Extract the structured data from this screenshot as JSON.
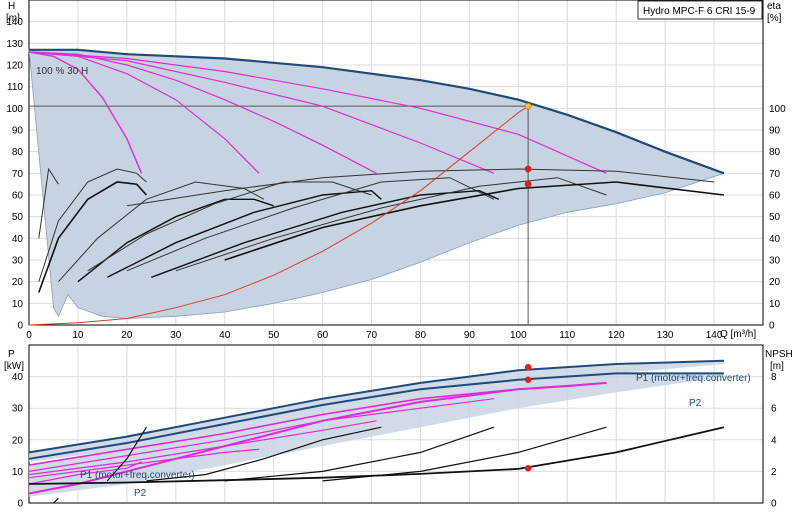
{
  "title": "Hydro MPC-F 6 CRI 15-9",
  "chart_data": [
    {
      "id": "head",
      "type": "line",
      "ylabel_left": "H",
      "yunit_left": "[m]",
      "ylabel_right": "eta",
      "yunit_right": "[%]",
      "xlabel": "Q [m³/h]",
      "xlim": [
        0,
        150
      ],
      "ylim": [
        0,
        150
      ],
      "ylim_right": [
        0,
        150
      ],
      "xticks": [
        "0",
        "10",
        "20",
        "30",
        "40",
        "50",
        "60",
        "70",
        "80",
        "90",
        "100",
        "110",
        "120",
        "130",
        "140"
      ],
      "yticks_left": [
        "0",
        "10",
        "20",
        "30",
        "40",
        "50",
        "60",
        "70",
        "80",
        "90",
        "100",
        "110",
        "120",
        "130",
        "140"
      ],
      "yticks_right": [
        "0",
        "10",
        "20",
        "30",
        "40",
        "50",
        "60",
        "70",
        "80",
        "90",
        "100"
      ],
      "annotation": "100 % 30 H",
      "grid": true,
      "duty_point": {
        "x": 102,
        "y": 101
      },
      "envelope": {
        "x": [
          0,
          5,
          10,
          15,
          20,
          30,
          40,
          50,
          60,
          70,
          80,
          90,
          100,
          110,
          120,
          130,
          142,
          142,
          130,
          120,
          110,
          100,
          90,
          80,
          70,
          60,
          50,
          40,
          30,
          20,
          15,
          10,
          8,
          6,
          5
        ],
        "y": [
          127,
          127,
          127,
          126,
          125,
          124,
          123,
          121,
          119,
          116,
          113,
          109,
          104,
          97,
          89,
          80,
          70,
          70,
          61,
          56,
          52,
          46,
          38,
          29,
          21,
          15,
          10,
          6,
          4,
          3,
          4,
          8,
          14,
          4,
          8
        ]
      },
      "series": [
        {
          "color": "#1f4a7a",
          "width": 2.2,
          "x": [
            0,
            10,
            20,
            30,
            40,
            50,
            60,
            70,
            80,
            90,
            100,
            110,
            120,
            130,
            142
          ],
          "y": [
            127,
            127,
            125,
            124,
            123,
            121,
            119,
            116,
            113,
            109,
            104,
            97,
            89,
            80,
            70
          ]
        },
        {
          "color": "#e02ad8",
          "width": 1.4,
          "x": [
            0,
            5,
            10,
            15,
            20,
            23
          ],
          "y": [
            126,
            124,
            118,
            105,
            86,
            70
          ]
        },
        {
          "color": "#e02ad8",
          "width": 1.2,
          "x": [
            0,
            10,
            20,
            30,
            40,
            47
          ],
          "y": [
            126,
            124,
            116,
            104,
            86,
            70
          ]
        },
        {
          "color": "#e02ad8",
          "width": 1.2,
          "x": [
            0,
            10,
            20,
            30,
            40,
            50,
            60,
            71
          ],
          "y": [
            126,
            125,
            120,
            113,
            104,
            94,
            83,
            70
          ]
        },
        {
          "color": "#e02ad8",
          "width": 1.2,
          "x": [
            0,
            20,
            40,
            60,
            80,
            95
          ],
          "y": [
            126,
            122,
            112,
            101,
            84,
            70
          ]
        },
        {
          "color": "#e02ad8",
          "width": 1.2,
          "x": [
            0,
            20,
            40,
            60,
            80,
            100,
            118
          ],
          "y": [
            126,
            123,
            117,
            109,
            100,
            88,
            70
          ]
        },
        {
          "color": "#333333",
          "width": 1,
          "x": [
            2,
            4,
            6
          ],
          "y": [
            40,
            72,
            65
          ]
        },
        {
          "color": "#333333",
          "width": 1,
          "x": [
            2,
            6,
            12,
            18,
            22,
            24
          ],
          "y": [
            20,
            48,
            66,
            72,
            70,
            66
          ]
        },
        {
          "color": "#111111",
          "width": 1.6,
          "x": [
            2,
            6,
            12,
            18,
            22,
            24
          ],
          "y": [
            15,
            40,
            58,
            66,
            65,
            60
          ]
        },
        {
          "color": "#333333",
          "width": 1,
          "x": [
            6,
            14,
            24,
            34,
            44,
            48
          ],
          "y": [
            20,
            40,
            58,
            66,
            63,
            58
          ]
        },
        {
          "color": "#111111",
          "width": 1.4,
          "x": [
            10,
            20,
            30,
            40,
            46,
            50
          ],
          "y": [
            20,
            38,
            50,
            58,
            58,
            55
          ]
        },
        {
          "color": "#333333",
          "width": 1,
          "x": [
            12,
            24,
            38,
            52,
            62,
            70
          ],
          "y": [
            25,
            42,
            56,
            66,
            66,
            60
          ]
        },
        {
          "color": "#111111",
          "width": 1.4,
          "x": [
            16,
            30,
            46,
            60,
            70,
            72
          ],
          "y": [
            22,
            38,
            52,
            60,
            62,
            58
          ]
        },
        {
          "color": "#333333",
          "width": 1,
          "x": [
            20,
            36,
            54,
            72,
            86,
            95
          ],
          "y": [
            25,
            40,
            54,
            66,
            68,
            58
          ]
        },
        {
          "color": "#111111",
          "width": 1.4,
          "x": [
            25,
            44,
            64,
            80,
            92,
            96
          ],
          "y": [
            22,
            38,
            52,
            60,
            62,
            58
          ]
        },
        {
          "color": "#333333",
          "width": 1,
          "x": [
            30,
            50,
            72,
            92,
            108,
            118
          ],
          "y": [
            25,
            40,
            54,
            64,
            68,
            60
          ]
        },
        {
          "color": "#111111",
          "width": 1.6,
          "x": [
            40,
            60,
            80,
            100,
            120,
            142
          ],
          "y": [
            30,
            45,
            55,
            63,
            66,
            60
          ]
        },
        {
          "color": "#333333",
          "width": 1,
          "x": [
            20,
            40,
            60,
            80,
            100,
            120,
            140
          ],
          "y": [
            55,
            62,
            68,
            71,
            72,
            71,
            66
          ]
        },
        {
          "color": "#e33a2a",
          "width": 1,
          "x": [
            0,
            10,
            20,
            30,
            40,
            50,
            60,
            70,
            80,
            90,
            100,
            102
          ],
          "y": [
            0,
            1,
            3,
            8,
            14,
            23,
            34,
            47,
            62,
            80,
            98,
            101
          ]
        }
      ],
      "markers": [
        {
          "x": 102,
          "y": 101,
          "color": "#f2c11a"
        },
        {
          "x": 102,
          "y": 72,
          "color": "#e41c1c"
        },
        {
          "x": 102,
          "y": 65,
          "color": "#e41c1c"
        }
      ]
    },
    {
      "id": "power",
      "type": "line",
      "ylabel_left": "P",
      "yunit_left": "[kW]",
      "ylabel_right": "NPSH",
      "yunit_right": "[m]",
      "xlim": [
        0,
        150
      ],
      "ylim": [
        0,
        50
      ],
      "ylim_right": [
        0,
        10
      ],
      "yticks_left": [
        "0",
        "10",
        "20",
        "30",
        "40"
      ],
      "yticks_right": [
        "0",
        "2",
        "4",
        "6",
        "8"
      ],
      "label_p1_top": "P1 (motor+freq.converter)",
      "label_p2_top": "P2",
      "label_p1_low": "P1 (motor+freq.converter)",
      "label_p2_low": "P2",
      "bands": [
        {
          "x": [
            0,
            20,
            40,
            60,
            80,
            100,
            120,
            142
          ],
          "y_lo": [
            13,
            17,
            23,
            29,
            34,
            38,
            41,
            44
          ],
          "y_hi": [
            16,
            21,
            27,
            33,
            38,
            42,
            44,
            45
          ]
        },
        {
          "x": [
            0,
            20,
            40,
            60,
            80,
            100,
            120,
            142
          ],
          "y_lo": [
            2,
            6,
            12,
            18,
            24,
            30,
            35,
            40
          ],
          "y_hi": [
            12,
            17,
            23,
            29,
            34,
            38,
            41,
            41
          ]
        }
      ],
      "series": [
        {
          "color": "#1f4a7a",
          "width": 2,
          "x": [
            0,
            20,
            40,
            60,
            80,
            100,
            120,
            142
          ],
          "y": [
            16,
            21,
            27,
            33,
            38,
            42,
            44,
            45
          ]
        },
        {
          "color": "#1f4a7a",
          "width": 2,
          "x": [
            0,
            20,
            40,
            60,
            80,
            100,
            120,
            142
          ],
          "y": [
            14,
            19,
            25,
            31,
            36,
            39,
            41,
            41
          ]
        },
        {
          "color": "#e02ad8",
          "width": 1.6,
          "x": [
            0,
            20,
            40,
            60,
            80,
            100,
            118
          ],
          "y": [
            12,
            17,
            22,
            28,
            33,
            36,
            38
          ]
        },
        {
          "color": "#e02ad8",
          "width": 1.2,
          "x": [
            0,
            20,
            40,
            60,
            80,
            95
          ],
          "y": [
            10,
            15,
            20,
            26,
            30,
            33
          ]
        },
        {
          "color": "#e02ad8",
          "width": 1.2,
          "x": [
            0,
            20,
            40,
            60,
            71
          ],
          "y": [
            9,
            13,
            18,
            23,
            26
          ]
        },
        {
          "color": "#e02ad8",
          "width": 1.2,
          "x": [
            0,
            20,
            40,
            47
          ],
          "y": [
            8,
            12,
            16,
            17
          ]
        },
        {
          "color": "#e02ad8",
          "width": 1.2,
          "x": [
            0,
            10,
            20,
            23
          ],
          "y": [
            6,
            9,
            11,
            13
          ]
        },
        {
          "color": "#e02ad8",
          "width": 2,
          "x": [
            0,
            10,
            20,
            30,
            40,
            50,
            60,
            70,
            80,
            90,
            100,
            110,
            118
          ],
          "y": [
            3,
            6,
            10,
            14,
            18,
            22,
            26,
            29,
            32,
            34,
            36,
            37,
            38
          ]
        },
        {
          "color": "#111111",
          "width": 1.2,
          "x": [
            16,
            20,
            24
          ],
          "y": [
            7,
            14,
            24
          ]
        },
        {
          "color": "#111111",
          "width": 1.2,
          "x": [
            24,
            36,
            48,
            60,
            72
          ],
          "y": [
            7,
            9,
            14,
            20,
            24
          ]
        },
        {
          "color": "#111111",
          "width": 1.2,
          "x": [
            40,
            60,
            80,
            95
          ],
          "y": [
            7,
            10,
            16,
            24
          ]
        },
        {
          "color": "#111111",
          "width": 1.2,
          "x": [
            60,
            80,
            100,
            118
          ],
          "y": [
            7,
            10,
            16,
            24
          ]
        },
        {
          "color": "#111111",
          "width": 1.8,
          "x": [
            0,
            20,
            40,
            60,
            80,
            100,
            120,
            142
          ],
          "y": [
            6,
            6.5,
            7.2,
            8,
            9.2,
            10.8,
            16,
            24
          ]
        },
        {
          "color": "#111111",
          "width": 1.2,
          "x": [
            5,
            6
          ],
          "y": [
            0,
            1.5
          ]
        }
      ],
      "markers": [
        {
          "x": 102,
          "y": 43,
          "color": "#e41c1c"
        },
        {
          "x": 102,
          "y": 39,
          "color": "#e41c1c"
        },
        {
          "x": 102,
          "y": 11,
          "color": "#e41c1c"
        }
      ]
    }
  ]
}
